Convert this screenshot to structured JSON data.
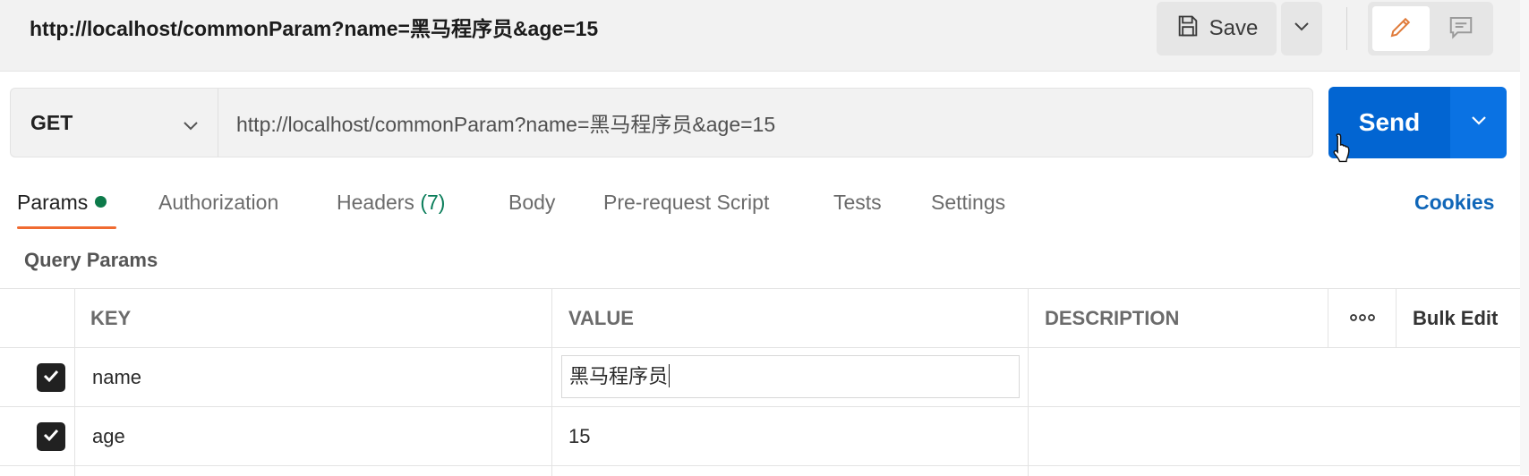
{
  "tab": {
    "title": "http://localhost/commonParam?name=黑马程序员&age=15"
  },
  "toolbar": {
    "save_label": "Save",
    "save_icon": "save-icon",
    "edit_icon": "pencil-icon",
    "comment_icon": "comment-icon"
  },
  "request": {
    "method": "GET",
    "url": "http://localhost/commonParam?name=黑马程序员&age=15",
    "send_label": "Send"
  },
  "tabs": [
    {
      "label": "Params",
      "active": true,
      "indicator": "dot"
    },
    {
      "label": "Authorization"
    },
    {
      "label": "Headers",
      "count": "(7)"
    },
    {
      "label": "Body"
    },
    {
      "label": "Pre-request Script"
    },
    {
      "label": "Tests"
    },
    {
      "label": "Settings"
    }
  ],
  "cookies_label": "Cookies",
  "query_params": {
    "title": "Query Params",
    "columns": {
      "key": "KEY",
      "value": "VALUE",
      "description": "DESCRIPTION",
      "bulk_edit": "Bulk Edit"
    },
    "rows": [
      {
        "checked": true,
        "key": "name",
        "value": "黑马程序员",
        "description": ""
      },
      {
        "checked": true,
        "key": "age",
        "value": "15",
        "description": ""
      }
    ]
  },
  "colors": {
    "accent_send": "#0265d2",
    "tab_underline": "#f06b31",
    "params_dot": "#0d7a4a",
    "cookies_link": "#0f66b8",
    "headers_count": "#0a7d5a"
  }
}
